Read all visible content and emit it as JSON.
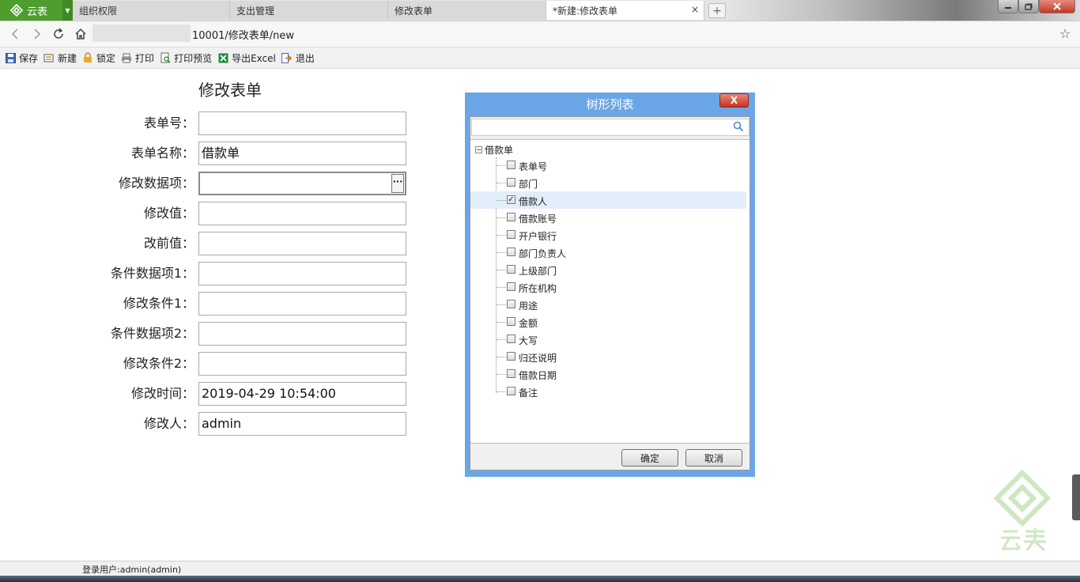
{
  "brand": {
    "name": "云表",
    "logo_icon": "yunbiao-logo-icon"
  },
  "tabs": [
    {
      "label": "组织权限"
    },
    {
      "label": "支出管理"
    },
    {
      "label": "修改表单"
    },
    {
      "label": "*新建:修改表单",
      "close": "×"
    }
  ],
  "address": {
    "url": "10001/修改表单/new"
  },
  "toolbar": {
    "save": "保存",
    "new": "新建",
    "lock": "锁定",
    "print": "打印",
    "print_preview": "打印预览",
    "export_excel": "导出Excel",
    "exit": "退出"
  },
  "form": {
    "title": "修改表单",
    "fields": [
      {
        "label": "表单号：",
        "value": ""
      },
      {
        "label": "表单名称：",
        "value": "借款单"
      },
      {
        "label": "修改数据项：",
        "value": "",
        "button": "···"
      },
      {
        "label": "修改值：",
        "value": ""
      },
      {
        "label": "改前值：",
        "value": ""
      },
      {
        "label": "条件数据项1：",
        "value": ""
      },
      {
        "label": "修改条件1：",
        "value": ""
      },
      {
        "label": "条件数据项2：",
        "value": ""
      },
      {
        "label": "修改条件2：",
        "value": ""
      },
      {
        "label": "修改时间：",
        "value": "2019-04-29 10:54:00"
      },
      {
        "label": "修改人：",
        "value": "admin"
      }
    ]
  },
  "dialog": {
    "title": "树形列表",
    "close_label": "X",
    "search_value": "",
    "tree": {
      "root": "借款单",
      "items": [
        {
          "label": "表单号",
          "checked": false
        },
        {
          "label": "部门",
          "checked": false
        },
        {
          "label": "借款人",
          "checked": true
        },
        {
          "label": "借款账号",
          "checked": false
        },
        {
          "label": "开户银行",
          "checked": false
        },
        {
          "label": "部门负责人",
          "checked": false
        },
        {
          "label": "上级部门",
          "checked": false
        },
        {
          "label": "所在机构",
          "checked": false
        },
        {
          "label": "用途",
          "checked": false
        },
        {
          "label": "金额",
          "checked": false
        },
        {
          "label": "大写",
          "checked": false
        },
        {
          "label": "归还说明",
          "checked": false
        },
        {
          "label": "借款日期",
          "checked": false
        },
        {
          "label": "备注",
          "checked": false
        }
      ]
    },
    "ok_label": "确定",
    "cancel_label": "取消"
  },
  "status": {
    "login_user": "登录用户:admin(admin)"
  },
  "colors": {
    "brand_green": "#4e9e2d",
    "dialog_blue": "#6aa6e6",
    "close_red": "#c7331d"
  }
}
